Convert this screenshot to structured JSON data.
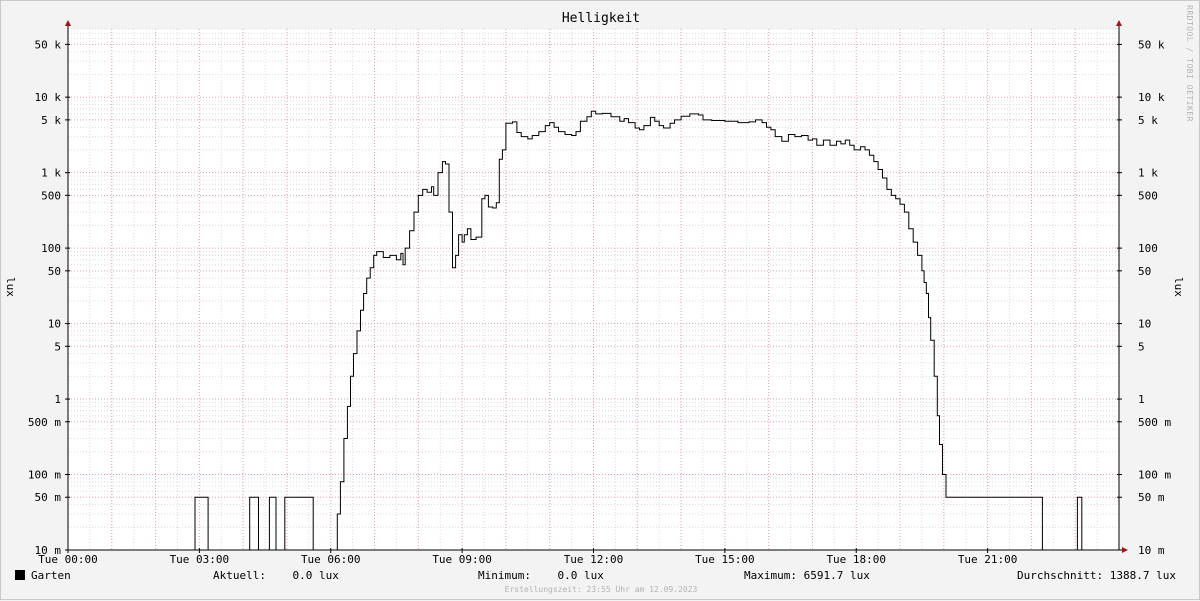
{
  "title": "Helligkeit",
  "watermark": "RRDTOOL / TOBI OETIKER",
  "footer_note": "Erstellungszeit: 23:55 Uhr am 12.09.2023",
  "legend": {
    "series_name": "Garten",
    "series_color": "#000000",
    "current": "Aktuell:    0.0 lux",
    "minimum": "Minimum:    0.0 lux",
    "maximum": "Maximum: 6591.7 lux",
    "average": "Durchschnitt: 1388.7 lux"
  },
  "colors": {
    "background": "#f3f3f3",
    "canvas": "#ffffff",
    "major_grid": "#e8a0a8",
    "minor_grid": "#dcdcdc",
    "line": "#000000",
    "arrow": "#aa1111"
  },
  "chart_data": {
    "type": "line",
    "title": "Helligkeit",
    "xlabel": "",
    "ylabel": "lux",
    "y_scale": "log",
    "ylim": [
      0.01,
      80000
    ],
    "xlim_hours": [
      0,
      24
    ],
    "x_ticks": [
      {
        "h": 0,
        "label": "Tue 00:00"
      },
      {
        "h": 3,
        "label": "Tue 03:00"
      },
      {
        "h": 6,
        "label": "Tue 06:00"
      },
      {
        "h": 9,
        "label": "Tue 09:00"
      },
      {
        "h": 12,
        "label": "Tue 12:00"
      },
      {
        "h": 15,
        "label": "Tue 15:00"
      },
      {
        "h": 18,
        "label": "Tue 18:00"
      },
      {
        "h": 21,
        "label": "Tue 21:00"
      }
    ],
    "y_ticks": [
      {
        "v": 0.01,
        "label": "10 m"
      },
      {
        "v": 0.05,
        "label": "50 m"
      },
      {
        "v": 0.1,
        "label": "100 m"
      },
      {
        "v": 0.5,
        "label": "500 m"
      },
      {
        "v": 1,
        "label": "1"
      },
      {
        "v": 5,
        "label": "5"
      },
      {
        "v": 10,
        "label": "10"
      },
      {
        "v": 50,
        "label": "50"
      },
      {
        "v": 100,
        "label": "100"
      },
      {
        "v": 500,
        "label": "500"
      },
      {
        "v": 1000,
        "label": "1 k"
      },
      {
        "v": 5000,
        "label": "5 k"
      },
      {
        "v": 10000,
        "label": "10 k"
      },
      {
        "v": 50000,
        "label": "50 k"
      }
    ],
    "grid": true,
    "series": [
      {
        "name": "Garten",
        "points": [
          [
            0,
            0.01
          ],
          [
            2.9,
            0.01
          ],
          [
            2.9,
            0.05
          ],
          [
            3.2,
            0.05
          ],
          [
            3.2,
            0.01
          ],
          [
            4.15,
            0.01
          ],
          [
            4.15,
            0.05
          ],
          [
            4.35,
            0.05
          ],
          [
            4.35,
            0.01
          ],
          [
            4.6,
            0.01
          ],
          [
            4.6,
            0.05
          ],
          [
            4.75,
            0.05
          ],
          [
            4.75,
            0.01
          ],
          [
            4.95,
            0.01
          ],
          [
            4.95,
            0.05
          ],
          [
            5.6,
            0.05
          ],
          [
            5.6,
            0.01
          ],
          [
            6.15,
            0.01
          ],
          [
            6.15,
            0.03
          ],
          [
            6.22,
            0.08
          ],
          [
            6.3,
            0.3
          ],
          [
            6.38,
            0.8
          ],
          [
            6.45,
            2
          ],
          [
            6.52,
            4
          ],
          [
            6.6,
            8
          ],
          [
            6.68,
            15
          ],
          [
            6.75,
            25
          ],
          [
            6.82,
            40
          ],
          [
            6.9,
            55
          ],
          [
            6.98,
            80
          ],
          [
            7.05,
            90
          ],
          [
            7.2,
            75
          ],
          [
            7.35,
            80
          ],
          [
            7.5,
            70
          ],
          [
            7.6,
            85
          ],
          [
            7.65,
            60
          ],
          [
            7.7,
            100
          ],
          [
            7.8,
            170
          ],
          [
            7.9,
            300
          ],
          [
            8.0,
            500
          ],
          [
            8.1,
            600
          ],
          [
            8.2,
            550
          ],
          [
            8.3,
            650
          ],
          [
            8.35,
            500
          ],
          [
            8.45,
            1000
          ],
          [
            8.55,
            1400
          ],
          [
            8.62,
            1300
          ],
          [
            8.7,
            300
          ],
          [
            8.78,
            55
          ],
          [
            8.85,
            80
          ],
          [
            8.92,
            150
          ],
          [
            9.0,
            120
          ],
          [
            9.05,
            150
          ],
          [
            9.12,
            180
          ],
          [
            9.2,
            130
          ],
          [
            9.32,
            140
          ],
          [
            9.45,
            450
          ],
          [
            9.52,
            500
          ],
          [
            9.6,
            350
          ],
          [
            9.7,
            340
          ],
          [
            9.78,
            400
          ],
          [
            9.85,
            1500
          ],
          [
            9.92,
            2000
          ],
          [
            10.0,
            4500
          ],
          [
            10.15,
            4700
          ],
          [
            10.25,
            3400
          ],
          [
            10.35,
            3000
          ],
          [
            10.5,
            2800
          ],
          [
            10.6,
            3100
          ],
          [
            10.75,
            3500
          ],
          [
            10.9,
            4200
          ],
          [
            11.0,
            4600
          ],
          [
            11.1,
            4000
          ],
          [
            11.2,
            3500
          ],
          [
            11.35,
            3200
          ],
          [
            11.5,
            3100
          ],
          [
            11.6,
            3500
          ],
          [
            11.7,
            4800
          ],
          [
            11.85,
            5500
          ],
          [
            11.95,
            6500
          ],
          [
            12.05,
            6000
          ],
          [
            12.2,
            6100
          ],
          [
            12.4,
            5500
          ],
          [
            12.6,
            4800
          ],
          [
            12.7,
            5200
          ],
          [
            12.8,
            4600
          ],
          [
            12.95,
            3900
          ],
          [
            13.05,
            3700
          ],
          [
            13.15,
            4200
          ],
          [
            13.3,
            5400
          ],
          [
            13.4,
            4800
          ],
          [
            13.5,
            4200
          ],
          [
            13.6,
            3900
          ],
          [
            13.75,
            4500
          ],
          [
            13.85,
            5000
          ],
          [
            14.0,
            5600
          ],
          [
            14.2,
            6000
          ],
          [
            14.4,
            5800
          ],
          [
            14.5,
            5000
          ],
          [
            14.7,
            4900
          ],
          [
            15.0,
            4800
          ],
          [
            15.3,
            4600
          ],
          [
            15.55,
            4700
          ],
          [
            15.7,
            5000
          ],
          [
            15.85,
            4600
          ],
          [
            15.95,
            4000
          ],
          [
            16.05,
            3700
          ],
          [
            16.15,
            3000
          ],
          [
            16.3,
            2600
          ],
          [
            16.45,
            3200
          ],
          [
            16.6,
            3000
          ],
          [
            16.75,
            3100
          ],
          [
            16.9,
            2700
          ],
          [
            17.0,
            2800
          ],
          [
            17.1,
            2300
          ],
          [
            17.25,
            2700
          ],
          [
            17.4,
            2300
          ],
          [
            17.55,
            2600
          ],
          [
            17.65,
            2400
          ],
          [
            17.75,
            2700
          ],
          [
            17.85,
            2300
          ],
          [
            17.95,
            2000
          ],
          [
            18.1,
            2200
          ],
          [
            18.2,
            2000
          ],
          [
            18.3,
            1700
          ],
          [
            18.4,
            1400
          ],
          [
            18.5,
            1100
          ],
          [
            18.6,
            850
          ],
          [
            18.7,
            600
          ],
          [
            18.8,
            500
          ],
          [
            18.9,
            450
          ],
          [
            19.0,
            380
          ],
          [
            19.1,
            300
          ],
          [
            19.2,
            180
          ],
          [
            19.3,
            120
          ],
          [
            19.4,
            80
          ],
          [
            19.5,
            50
          ],
          [
            19.55,
            35
          ],
          [
            19.6,
            25
          ],
          [
            19.65,
            12
          ],
          [
            19.7,
            6
          ],
          [
            19.78,
            2
          ],
          [
            19.85,
            0.6
          ],
          [
            19.9,
            0.25
          ],
          [
            19.97,
            0.1
          ],
          [
            20.05,
            0.05
          ],
          [
            22.25,
            0.05
          ],
          [
            22.25,
            0.01
          ],
          [
            23.05,
            0.01
          ],
          [
            23.05,
            0.05
          ],
          [
            23.15,
            0.05
          ],
          [
            23.15,
            0.01
          ],
          [
            24,
            0.01
          ]
        ]
      }
    ]
  }
}
